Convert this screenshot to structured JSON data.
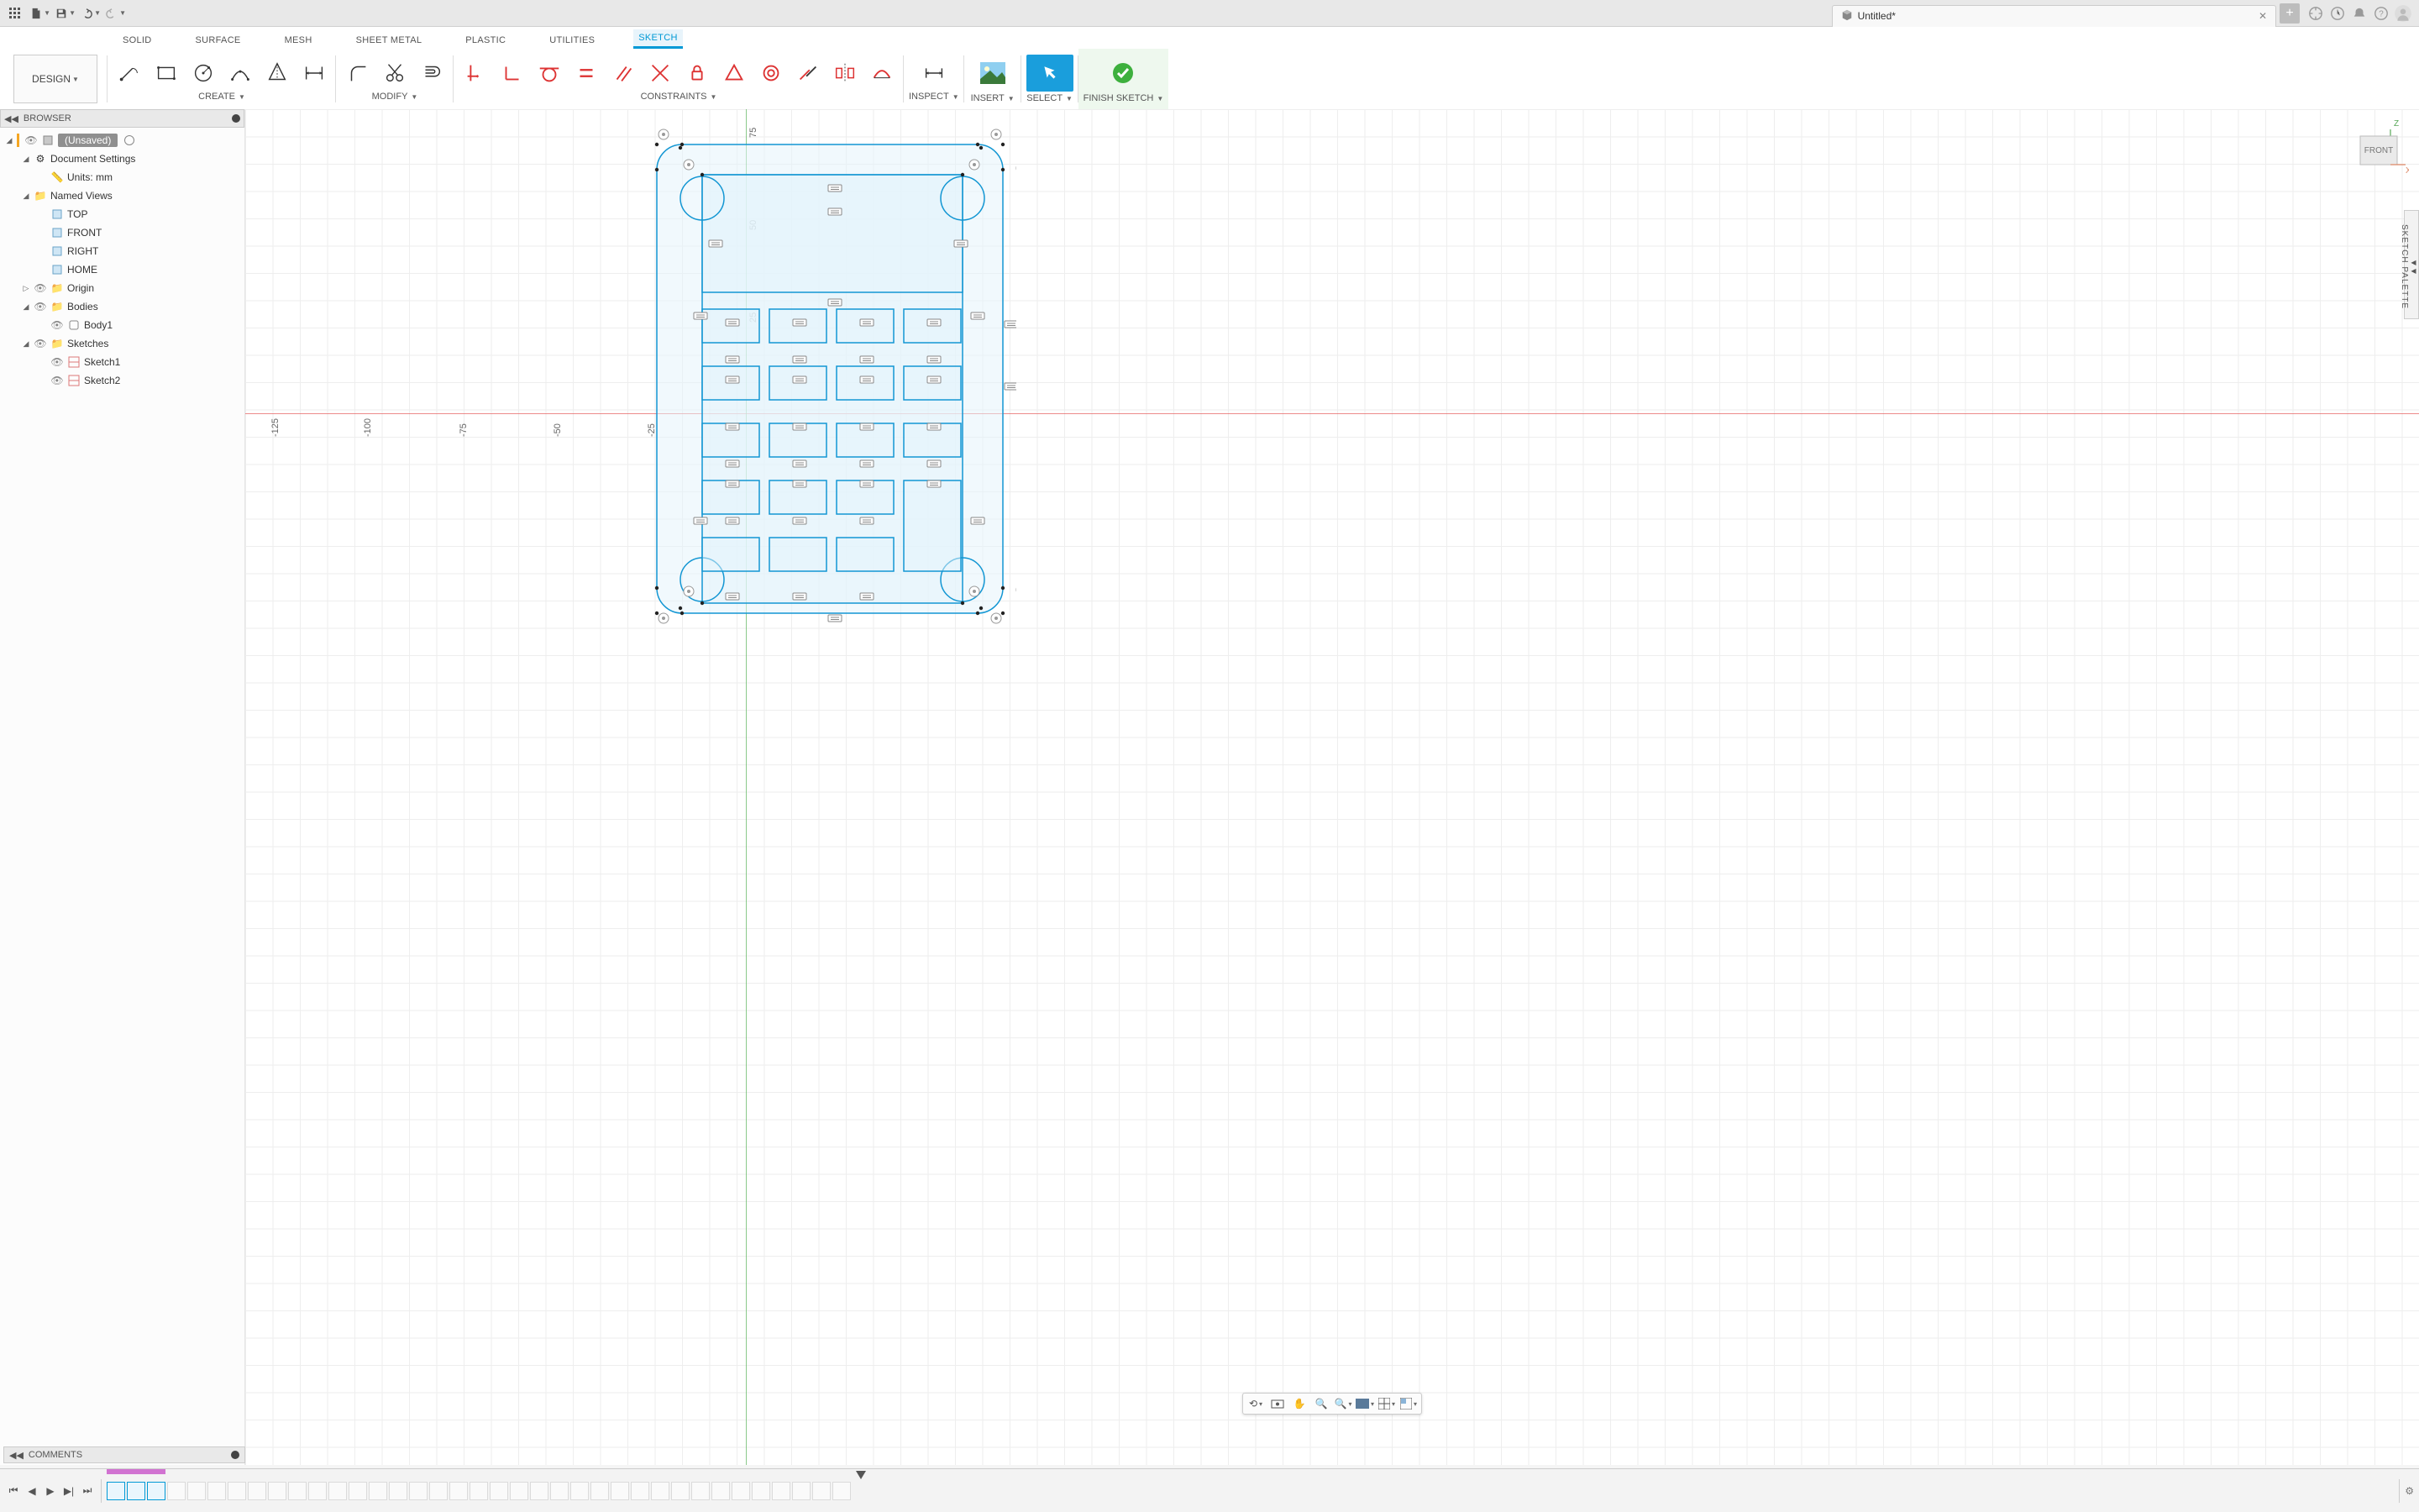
{
  "app": {
    "title": "Untitled*"
  },
  "sysbar_icons": [
    "apps",
    "file",
    "save",
    "undo",
    "redo"
  ],
  "sysbar_right_icons": [
    "extensions",
    "jobstatus",
    "notifications",
    "help",
    "profile"
  ],
  "ribbon": {
    "tabs": [
      "SOLID",
      "SURFACE",
      "MESH",
      "SHEET METAL",
      "PLASTIC",
      "UTILITIES",
      "SKETCH"
    ],
    "active_tab": "SKETCH",
    "design_label": "DESIGN",
    "groups": {
      "create": "CREATE",
      "modify": "MODIFY",
      "constraints": "CONSTRAINTS",
      "inspect": "INSPECT",
      "insert": "INSERT",
      "select": "SELECT",
      "finish": "FINISH SKETCH"
    }
  },
  "browser": {
    "title": "BROWSER",
    "root": "(Unsaved)",
    "docset": "Document Settings",
    "units": "Units: mm",
    "named_views": "Named Views",
    "views": [
      "TOP",
      "FRONT",
      "RIGHT",
      "HOME"
    ],
    "origin": "Origin",
    "bodies": "Bodies",
    "body_items": [
      "Body1"
    ],
    "sketches": "Sketches",
    "sketch_items": [
      "Sketch1",
      "Sketch2"
    ]
  },
  "canvas": {
    "ruler_x": [
      "-125",
      "-100",
      "-75",
      "-50",
      "-25"
    ],
    "ruler_y": [
      "75",
      "50",
      "25"
    ],
    "viewcube_face": "FRONT",
    "axes": {
      "x": "X",
      "z": "Z"
    }
  },
  "sidepanel": "SKETCH PALETTE",
  "comments": "COMMENTS",
  "timeline": {
    "item_count": 37,
    "sketch_indices": [
      0,
      1,
      2
    ]
  }
}
